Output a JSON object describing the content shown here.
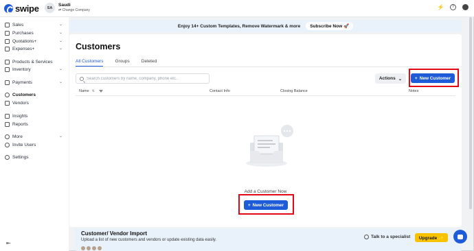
{
  "app": {
    "logo_text": "swipe"
  },
  "company": {
    "initials": "SA",
    "name": "Saudi",
    "change_label": "Change Company"
  },
  "top_icons": [
    "bolt-icon",
    "help-icon",
    "user-icon"
  ],
  "sidebar": {
    "items": [
      {
        "label": "Sales",
        "icon": "sales-icon",
        "has_chevron": true
      },
      {
        "label": "Purchases",
        "icon": "purchases-icon",
        "has_chevron": true
      },
      {
        "label": "Quotations+",
        "icon": "quotations-icon",
        "has_chevron": true
      },
      {
        "label": "Expenses+",
        "icon": "expenses-icon",
        "has_chevron": true
      },
      {
        "label": "Products & Services",
        "icon": "products-icon",
        "has_chevron": false
      },
      {
        "label": "Inventory",
        "icon": "inventory-icon",
        "has_chevron": true
      },
      {
        "label": "Payments",
        "icon": "payments-icon",
        "has_chevron": true
      },
      {
        "label": "Customers",
        "icon": "customers-icon",
        "has_chevron": false,
        "active": true
      },
      {
        "label": "Vendors",
        "icon": "vendors-icon",
        "has_chevron": false
      },
      {
        "label": "Insights",
        "icon": "insights-icon",
        "has_chevron": false
      },
      {
        "label": "Reports",
        "icon": "reports-icon",
        "has_chevron": false
      },
      {
        "label": "More",
        "icon": "more-icon",
        "has_chevron": true
      },
      {
        "label": "Invite Users",
        "icon": "invite-users-icon",
        "has_chevron": false
      },
      {
        "label": "Settings",
        "icon": "settings-icon",
        "has_chevron": false
      }
    ]
  },
  "banner": {
    "text": "Enjoy 14+ Custom Templates, Remove Watermark & more",
    "button_label": "Subscribe Now 🚀"
  },
  "main": {
    "title": "Customers",
    "tabs": [
      {
        "label": "All Customers",
        "active": true
      },
      {
        "label": "Groups"
      },
      {
        "label": "Deleted"
      }
    ],
    "search_placeholder": "Search customers by name, company, phone etc..",
    "actions_label": "Actions",
    "new_customer_label": "New Customer",
    "columns": [
      "Name",
      "Contact Info",
      "Closing Balance",
      "Notes"
    ],
    "empty_text": "Add a Customer Now",
    "empty_button_label": "New Customer"
  },
  "import": {
    "title": "Customer/ Vendor Import",
    "description": "Upload a list of new customers and vendors or update existing data easily.",
    "talk_label": "Talk to a specialist",
    "upgrade_label": "Upgrade ✨"
  },
  "colors": {
    "primary": "#1e5bd8",
    "highlight": "#e30613",
    "upgrade": "#f7c300",
    "banner": "#e9f1fb"
  }
}
